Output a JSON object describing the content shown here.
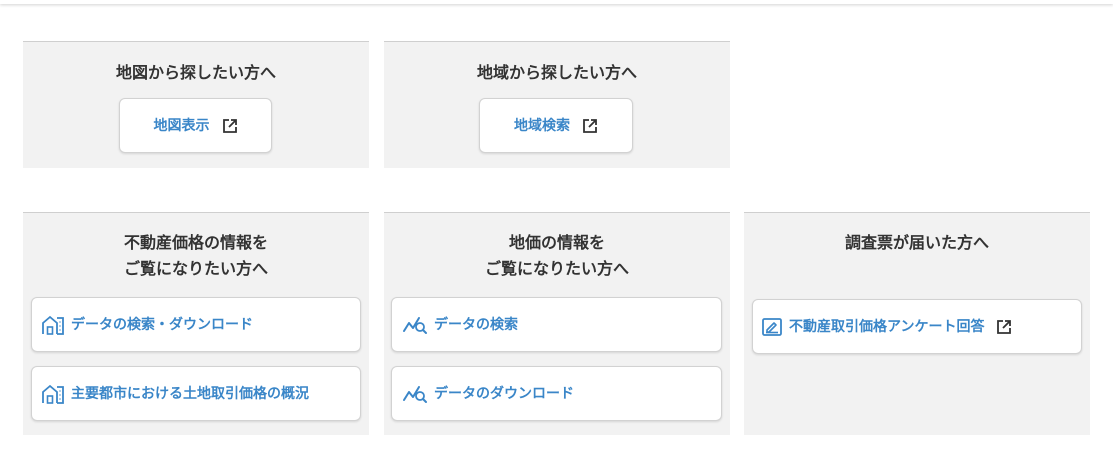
{
  "sections": {
    "map": {
      "title": "地図から探したい方へ",
      "button_label": "地図表示"
    },
    "area": {
      "title": "地域から探したい方へ",
      "button_label": "地域検索"
    },
    "realestate": {
      "title_line1": "不動産価格の情報を",
      "title_line2": "ご覧になりたい方へ",
      "items": [
        {
          "label": "データの検索・ダウンロード",
          "icon": "building-icon"
        },
        {
          "label": "主要都市における土地取引価格の概況",
          "icon": "building-icon"
        }
      ]
    },
    "landprice": {
      "title_line1": "地価の情報を",
      "title_line2": "ご覧になりたい方へ",
      "items": [
        {
          "label": "データの検索",
          "icon": "chart-search-icon"
        },
        {
          "label": "データのダウンロード",
          "icon": "chart-search-icon"
        }
      ]
    },
    "survey": {
      "title": "調査票が届いた方へ",
      "button_label": "不動産取引価格アンケート回答",
      "icon": "edit-form-icon"
    }
  },
  "colors": {
    "accent": "#3a86c8",
    "panel_bg": "#f2f2f2",
    "text": "#333333"
  }
}
